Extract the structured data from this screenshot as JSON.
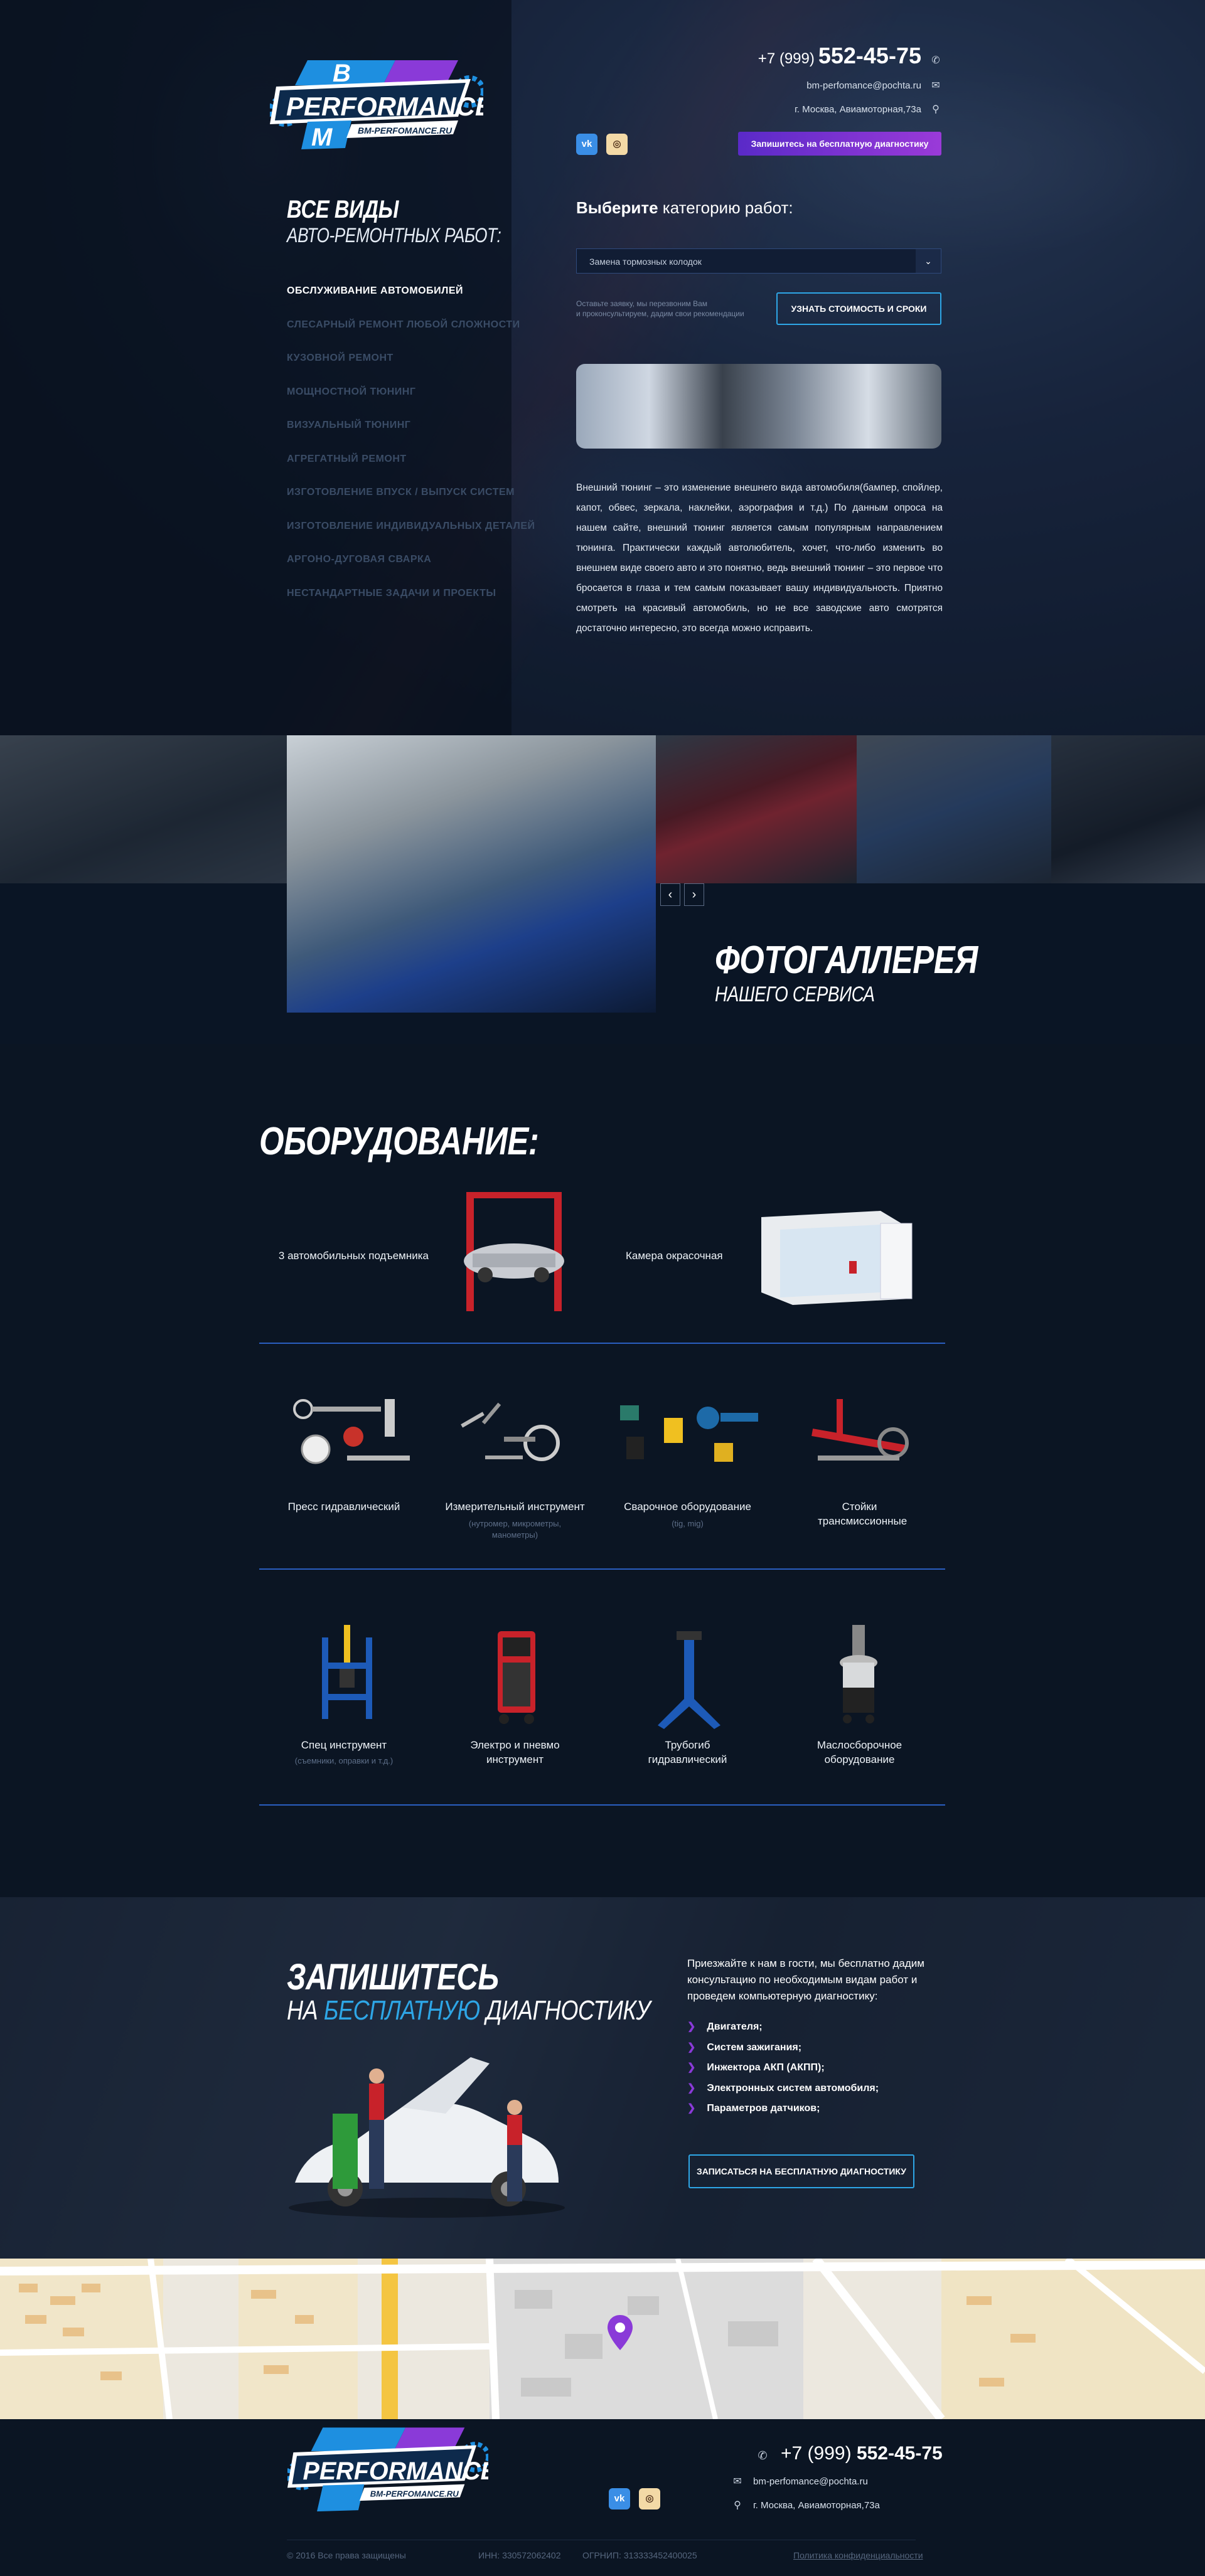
{
  "header": {
    "logo_text": "PERFORMANCE",
    "logo_site": "BM-PERFOMANCE.RU",
    "phone_prefix": "+7 (999)",
    "phone_number": "552-45-75",
    "email": "bm-perfomance@pochta.ru",
    "address": "г. Москва, Авиамоторная,73а",
    "cta_button": "Запишитесь на бесплатную диагностику",
    "social": {
      "vk": "vk",
      "instagram": "ig"
    },
    "colors": {
      "accent_blue": "#2ea6e6",
      "accent_purple": "#8a3ad8"
    }
  },
  "sidebar": {
    "title_line1": "ВСЕ ВИДЫ",
    "title_line2": "АВТО-РЕМОНТНЫХ РАБОТ:",
    "items": [
      {
        "label": "ОБСЛУЖИВАНИЕ АВТОМОБИЛЕЙ",
        "active": true
      },
      {
        "label": "СЛЕСАРНЫЙ РЕМОНТ ЛЮБОЙ СЛОЖНОСТИ",
        "active": false
      },
      {
        "label": "КУЗОВНОЙ РЕМОНТ",
        "active": false
      },
      {
        "label": "МОЩНОСТНОЙ ТЮНИНГ",
        "active": false
      },
      {
        "label": "ВИЗУАЛЬНЫЙ ТЮНИНГ",
        "active": false
      },
      {
        "label": "АГРЕГАТНЫЙ РЕМОНТ",
        "active": false
      },
      {
        "label": "ИЗГОТОВЛЕНИЕ ВПУСК / ВЫПУСК СИСТЕМ",
        "active": false
      },
      {
        "label": "ИЗГОТОВЛЕНИЕ ИНДИВИДУАЛЬНЫХ ДЕТАЛЕЙ",
        "active": false
      },
      {
        "label": "АРГОНО-ДУГОВАЯ СВАРКА",
        "active": false
      },
      {
        "label": "НЕСТАНДАРТНЫЕ ЗАДАЧИ И ПРОЕКТЫ",
        "active": false
      }
    ]
  },
  "category": {
    "title_bold": "Выберите",
    "title_rest": "категорию работ:",
    "selected": "Замена тормозных колодок",
    "note_line1": "Оставьте заявку, мы перезвоним Вам",
    "note_line2": "и проконсультируем, дадим свои рекомендации",
    "button": "УЗНАТЬ СТОИМОСТЬ И СРОКИ",
    "description": "Внешний тюнинг – это изменение внешнего вида автомобиля(бампер, спойлер, капот, обвес, зеркала, наклейки, аэрография и т.д.) По данным опроса на нашем сайте, внешний тюнинг является самым популярным направлением тюнинга. Практически каждый автолюбитель, хочет, что-либо изменить во внешнем виде своего авто и это понятно, ведь внешний тюнинг – это первое что бросается в глаза и тем самым показывает вашу индивидуальность. Приятно смотреть на красивый автомобиль, но не все заводские авто смотрятся достаточно интересно, это всегда можно исправить."
  },
  "gallery": {
    "title": "ФОТОГАЛЛЕРЕЯ",
    "subtitle": "НАШЕГО СЕРВИСА",
    "prev_icon": "chevron-left-icon",
    "next_icon": "chevron-right-icon"
  },
  "equipment": {
    "title": "ОБОРУДОВАНИЕ:",
    "row1": [
      {
        "label": "3 автомобильных подъемника"
      },
      {
        "label": "Камера окрасочная"
      }
    ],
    "row2": [
      {
        "label": "Пресс гидравлический",
        "sub": ""
      },
      {
        "label": "Измерительный инструмент",
        "sub": "(нутромер, микрометры, манометры)"
      },
      {
        "label": "Сварочное оборудование",
        "sub": "(tig, mig)"
      },
      {
        "label": "Стойки трансмиссионные",
        "sub": ""
      }
    ],
    "row3": [
      {
        "label": "Спец инструмент",
        "sub": "(съемники, оправки и т.д.)"
      },
      {
        "label": "Электро и пневмо инструмент",
        "sub": ""
      },
      {
        "label": "Трубогиб гидравлический",
        "sub": ""
      },
      {
        "label": "Маслосборочное оборудование",
        "sub": ""
      }
    ]
  },
  "signup": {
    "title": "ЗАПИШИТЕСЬ",
    "subtitle_pre": "НА",
    "subtitle_accent": "БЕСПЛАТНУЮ",
    "subtitle_post": "ДИАГНОСТИКУ",
    "intro": "Приезжайте к нам в гости, мы бесплатно дадим консультацию по необходимым видам работ и проведем компьютерную диагностику:",
    "items": [
      "Двигателя;",
      "Систем зажигания;",
      "Инжектора АКП (АКПП);",
      "Электронных систем автомобиля;",
      "Параметров датчиков;"
    ],
    "button": "ЗАПИСАТЬСЯ НА БЕСПЛАТНУЮ ДИАГНОСТИКУ"
  },
  "footer": {
    "phone_prefix": "+7 (999)",
    "phone_number": "552-45-75",
    "email": "bm-perfomance@pochta.ru",
    "address": "г. Москва, Авиамоторная,73а",
    "copyright": "© 2016 Все права защищены",
    "inn": "ИНН: 330572062402",
    "ogrnip": "ОГРНИП: 313333452400025",
    "privacy": "Политика конфиденциальности"
  }
}
